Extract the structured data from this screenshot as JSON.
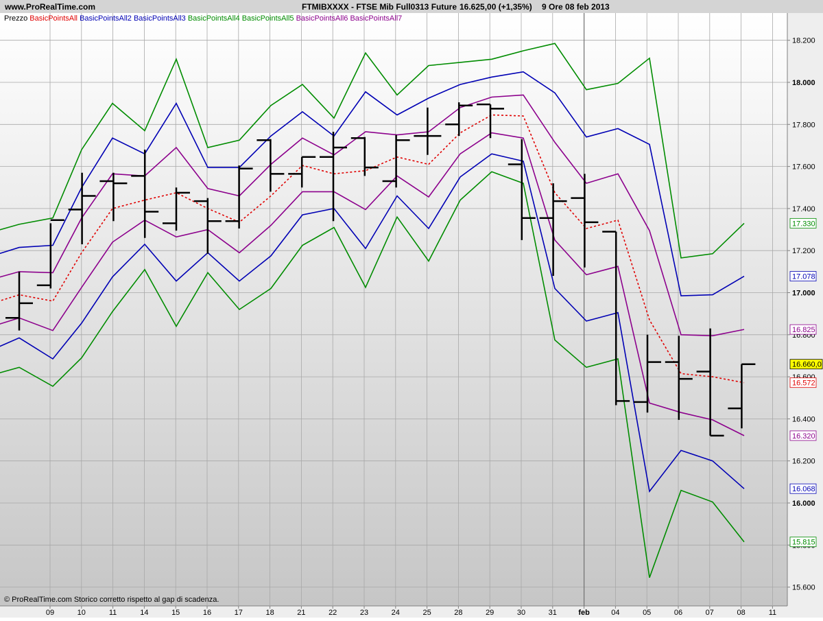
{
  "header": {
    "site": "www.ProRealTime.com",
    "title": "FTMIBXXXX - FTSE Mib Full0313 Future",
    "price_change": "16.625,00 (+1,35%)",
    "timeframe_date": "9 Ore   08 feb 2013"
  },
  "footer_note": "© ProRealTime.com  Storico corretto rispetto al gap di scadenza.",
  "colors": {
    "bands4": "#008c00",
    "bands2": "#0000b4",
    "bands6": "#8c008c",
    "pivot": "#e00000",
    "bars": "#000000",
    "last_price_bg": "#ffff00"
  },
  "chart_data": {
    "type": "line",
    "title": "FTMIBXXXX - FTSE Mib Full0313 Future",
    "legend": [
      "Prezzo",
      "BasicPointsAll",
      "BasicPointsAll2",
      "BasicPointsAll3",
      "BasicPointsAll4",
      "BasicPointsAll5",
      "BasicPointsAll6",
      "BasicPointsAll7"
    ],
    "legend_placement": "top-left",
    "ylim": [
      15510,
      18300
    ],
    "y_ticks": [
      {
        "v": 15600,
        "label": "15.600",
        "bold": false
      },
      {
        "v": 15800,
        "label": "15.800",
        "bold": false
      },
      {
        "v": 16000,
        "label": "16.000",
        "bold": true
      },
      {
        "v": 16200,
        "label": "16.200",
        "bold": false
      },
      {
        "v": 16400,
        "label": "16.400",
        "bold": false
      },
      {
        "v": 16600,
        "label": "16.600",
        "bold": false
      },
      {
        "v": 16800,
        "label": "16.800",
        "bold": false
      },
      {
        "v": 17000,
        "label": "17.000",
        "bold": true
      },
      {
        "v": 17200,
        "label": "17.200",
        "bold": false
      },
      {
        "v": 17400,
        "label": "17.400",
        "bold": false
      },
      {
        "v": 17600,
        "label": "17.600",
        "bold": false
      },
      {
        "v": 17800,
        "label": "17.800",
        "bold": false
      },
      {
        "v": 18000,
        "label": "18.000",
        "bold": true
      },
      {
        "v": 18200,
        "label": "18.200",
        "bold": false
      }
    ],
    "x_ticks": [
      "09",
      "10",
      "11",
      "14",
      "15",
      "16",
      "17",
      "18",
      "21",
      "22",
      "23",
      "24",
      "25",
      "28",
      "29",
      "30",
      "31",
      "feb",
      "04",
      "05",
      "06",
      "07",
      "08",
      "11"
    ],
    "month_separator_index": 17,
    "grid": true,
    "series": [
      {
        "key": "g_upper",
        "color": "#008c00",
        "style": "solid",
        "values": [
          17280,
          17325,
          17355,
          17680,
          17900,
          17770,
          18110,
          17690,
          17725,
          17890,
          17990,
          17830,
          18140,
          17940,
          18080,
          18095,
          18110,
          18150,
          18185,
          17965,
          17995,
          18115,
          17165,
          17185,
          17330
        ]
      },
      {
        "key": "b_upper",
        "color": "#0000b4",
        "style": "solid",
        "values": [
          17165,
          17215,
          17225,
          17500,
          17735,
          17660,
          17900,
          17595,
          17595,
          17745,
          17860,
          17745,
          17955,
          17845,
          17925,
          17990,
          18025,
          18050,
          17950,
          17740,
          17780,
          17705,
          16985,
          16990,
          17078
        ]
      },
      {
        "key": "p_upper",
        "color": "#8c008c",
        "style": "solid",
        "values": [
          17055,
          17100,
          17095,
          17355,
          17565,
          17555,
          17690,
          17495,
          17460,
          17610,
          17735,
          17655,
          17765,
          17750,
          17765,
          17880,
          17930,
          17940,
          17715,
          17520,
          17565,
          17295,
          16800,
          16795,
          16825
        ]
      },
      {
        "key": "pivot",
        "color": "#e00000",
        "style": "dotted",
        "values": [
          16940,
          16990,
          16960,
          17190,
          17400,
          17440,
          17475,
          17400,
          17335,
          17460,
          17605,
          17565,
          17580,
          17645,
          17610,
          17760,
          17845,
          17840,
          17475,
          17305,
          17345,
          16870,
          16615,
          16600,
          16572
        ]
      },
      {
        "key": "p_lower",
        "color": "#8c008c",
        "style": "solid",
        "values": [
          16830,
          16880,
          16820,
          17025,
          17240,
          17345,
          17265,
          17300,
          17190,
          17320,
          17480,
          17480,
          17395,
          17555,
          17455,
          17660,
          17760,
          17735,
          17250,
          17085,
          17125,
          16475,
          16430,
          16395,
          16320
        ]
      },
      {
        "key": "b_lower",
        "color": "#0000b4",
        "style": "solid",
        "values": [
          16715,
          16785,
          16685,
          16855,
          17075,
          17230,
          17055,
          17190,
          17055,
          17175,
          17370,
          17400,
          17210,
          17460,
          17305,
          17550,
          17660,
          17625,
          17020,
          16865,
          16905,
          16055,
          16250,
          16200,
          16068
        ]
      },
      {
        "key": "g_lower",
        "color": "#008c00",
        "style": "solid",
        "values": [
          16600,
          16645,
          16555,
          16690,
          16910,
          17110,
          16840,
          17095,
          16920,
          17020,
          17225,
          17310,
          17025,
          17360,
          17150,
          17440,
          17575,
          17520,
          16775,
          16645,
          16685,
          15645,
          16060,
          16005,
          15815
        ]
      }
    ],
    "band_x_offsets": [
      -24.5,
      0,
      24.5,
      45.5,
      68,
      91.5,
      114.5,
      137.5,
      160.5,
      183.5,
      206.5,
      229.5,
      252.5,
      275.5,
      298.5,
      321.5,
      344.5,
      367.5,
      390.5,
      413.5,
      436.5,
      459.5,
      482.5,
      505.5,
      528.5
    ],
    "ohlc": [
      {
        "o": 16880,
        "h": 17100,
        "l": 16820,
        "c": 16950
      },
      {
        "o": 17035,
        "h": 17330,
        "l": 17020,
        "c": 17345
      },
      {
        "o": 17395,
        "h": 17570,
        "l": 17230,
        "c": 17460
      },
      {
        "o": 17530,
        "h": 17570,
        "l": 17340,
        "c": 17520
      },
      {
        "o": 17555,
        "h": 17680,
        "l": 17260,
        "c": 17385
      },
      {
        "o": 17330,
        "h": 17500,
        "l": 17295,
        "c": 17475
      },
      {
        "o": 17435,
        "h": 17450,
        "l": 17185,
        "c": 17340
      },
      {
        "o": 17340,
        "h": 17605,
        "l": 17305,
        "c": 17590
      },
      {
        "o": 17725,
        "h": 17730,
        "l": 17480,
        "c": 17565
      },
      {
        "o": 17565,
        "h": 17645,
        "l": 17500,
        "c": 17645
      },
      {
        "o": 17645,
        "h": 17765,
        "l": 17340,
        "c": 17690
      },
      {
        "o": 17735,
        "h": 17740,
        "l": 17555,
        "c": 17595
      },
      {
        "o": 17530,
        "h": 17750,
        "l": 17500,
        "c": 17725
      },
      {
        "o": 17745,
        "h": 17880,
        "l": 17655,
        "c": 17745
      },
      {
        "o": 17800,
        "h": 17905,
        "l": 17745,
        "c": 17890
      },
      {
        "o": 17895,
        "h": 17895,
        "l": 17735,
        "c": 17875
      },
      {
        "o": 17610,
        "h": 17730,
        "l": 17250,
        "c": 17355
      },
      {
        "o": 17355,
        "h": 17520,
        "l": 17080,
        "c": 17435
      },
      {
        "o": 17450,
        "h": 17565,
        "l": 17120,
        "c": 17335
      },
      {
        "o": 17290,
        "h": 17290,
        "l": 16465,
        "c": 16485
      },
      {
        "o": 16480,
        "h": 16800,
        "l": 16430,
        "c": 16670
      },
      {
        "o": 16670,
        "h": 16795,
        "l": 16395,
        "c": 16590
      },
      {
        "o": 16625,
        "h": 16830,
        "l": 16320,
        "c": 16320
      },
      {
        "o": 16450,
        "h": 16660,
        "l": 16355,
        "c": 16660
      }
    ],
    "value_labels": [
      {
        "value": 17330,
        "text": "17.330",
        "color": "#008c00",
        "highlight": false
      },
      {
        "value": 17078,
        "text": "17.078",
        "color": "#0000b4",
        "highlight": false
      },
      {
        "value": 16825,
        "text": "16.825",
        "color": "#8c008c",
        "highlight": false
      },
      {
        "value": 16660,
        "text": "16.660,0",
        "color": "#000000",
        "highlight": true
      },
      {
        "value": 16572,
        "text": "16.572",
        "color": "#e00000",
        "highlight": false
      },
      {
        "value": 16320,
        "text": "16.320",
        "color": "#8c008c",
        "highlight": false
      },
      {
        "value": 16068,
        "text": "16.068",
        "color": "#0000b4",
        "highlight": false
      },
      {
        "value": 15815,
        "text": "15.815",
        "color": "#008c00",
        "highlight": false
      }
    ]
  }
}
